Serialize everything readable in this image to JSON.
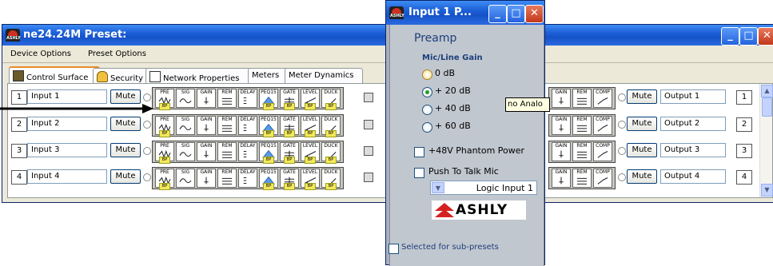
{
  "main": {
    "title": "ne24.24M   Preset:",
    "menu": [
      "Device Options",
      "Preset Options"
    ],
    "tabs": [
      "Control Surface",
      "Security",
      "Network Properties",
      "Meters",
      "Meter Dynamics"
    ],
    "block_labels": [
      "PRE",
      "SIG",
      "GAIN",
      "REM",
      "DELAY",
      "PEQ15",
      "GATE",
      "LEVEL",
      "DUCK"
    ],
    "bp_label": "BP",
    "mute_label": "Mute",
    "inputs": [
      {
        "num": "1",
        "name": "Input 1"
      },
      {
        "num": "2",
        "name": "Input 2"
      },
      {
        "num": "3",
        "name": "Input 3"
      },
      {
        "num": "4",
        "name": "Input 4"
      }
    ],
    "output_block_labels": [
      "GAIN",
      "REM",
      "COMP"
    ],
    "outputs": [
      {
        "num": "1",
        "name": "Output 1"
      },
      {
        "num": "2",
        "name": "Output 2"
      },
      {
        "num": "3",
        "name": "Output 3"
      },
      {
        "num": "4",
        "name": "Output 4"
      }
    ]
  },
  "popup": {
    "title": "Input 1   P...",
    "heading": "Preamp",
    "gain_label": "Mic/Line Gain",
    "gain_options": [
      "0 dB",
      "+ 20 dB",
      "+ 40 dB",
      "+ 60 dB"
    ],
    "gain_selected": "+ 20 dB",
    "phantom_label": "+48V Phantom Power",
    "ptt_label": "Push To Talk Mic",
    "logic_input": "Logic Input 1",
    "logo": "ASHLY",
    "subpreset_label": "Selected for sub-presets"
  },
  "tooltip": "no Analo"
}
